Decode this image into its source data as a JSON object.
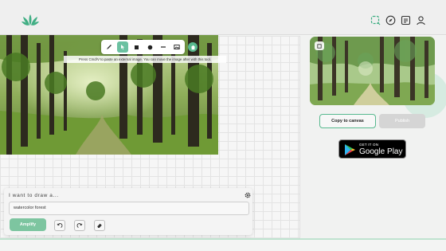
{
  "header": {
    "logo_icon": "leaf-logo-icon",
    "actions": [
      "canvas-icon",
      "compass-icon",
      "gallery-icon",
      "user-icon"
    ],
    "accent": "#3fae83"
  },
  "toolbar": {
    "tools": [
      "pencil-icon",
      "pointer-icon",
      "square-icon",
      "circle-icon",
      "line-icon",
      "image-icon"
    ],
    "active_tool": "pointer-icon",
    "tooltip": "Press Cmd/V to paste an external image. You can move the image after with this tool."
  },
  "prompt": {
    "title": "I want to draw a...",
    "value": "watercolor forest",
    "amplify_label": "Amplify"
  },
  "preview": {
    "copy_label": "Copy to canvas",
    "publish_label": "Publish"
  },
  "store_badge": {
    "line1": "GET IT ON",
    "line2": "Google Play"
  }
}
